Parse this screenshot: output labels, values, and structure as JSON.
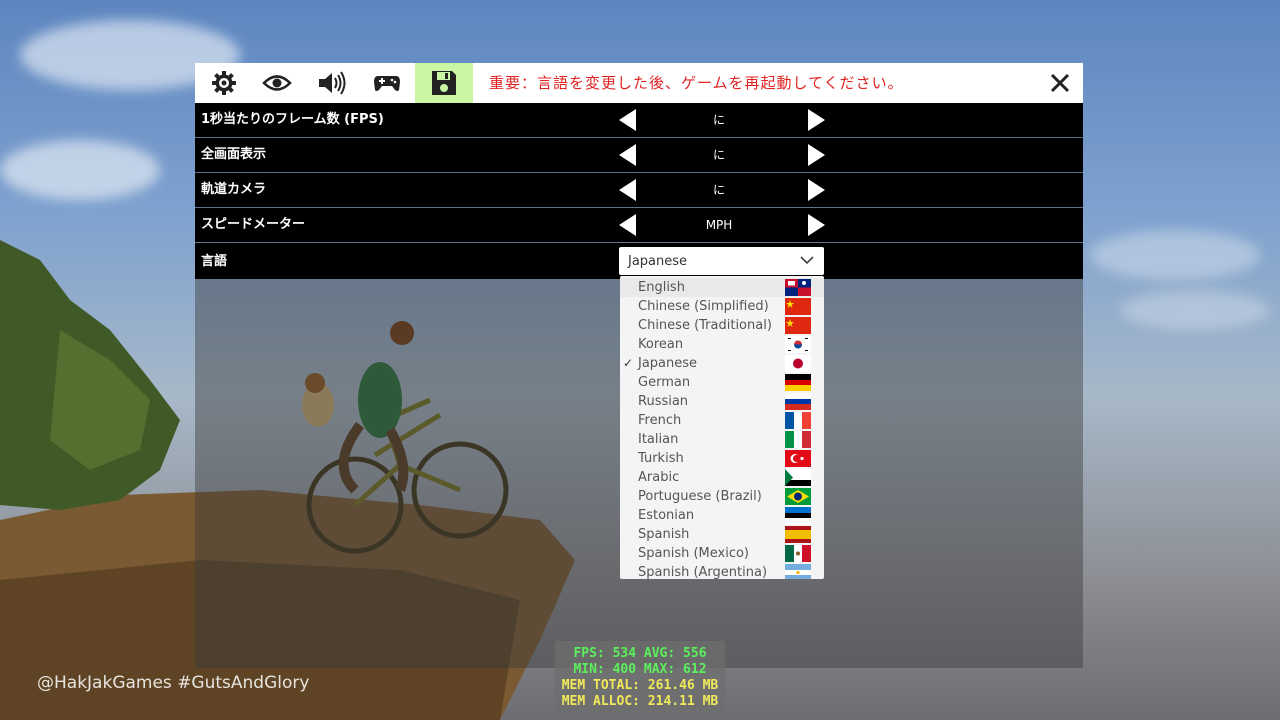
{
  "toolbar": {
    "tabs": [
      {
        "icon": "gear-icon",
        "active": false
      },
      {
        "icon": "eye-icon",
        "active": false
      },
      {
        "icon": "speaker-icon",
        "active": false
      },
      {
        "icon": "gamepad-icon",
        "active": false
      },
      {
        "icon": "save-icon",
        "active": true
      }
    ],
    "notice": "重要：言語を変更した後、ゲームを再起動してください。",
    "close_icon": "close-icon"
  },
  "settings": [
    {
      "label": "1秒当たりのフレーム数 (FPS)",
      "value": "に"
    },
    {
      "label": "全画面表示",
      "value": "に"
    },
    {
      "label": "軌道カメラ",
      "value": "に"
    },
    {
      "label": "スピードメーター",
      "value": "MPH"
    }
  ],
  "language": {
    "label": "言語",
    "selected": "Japanese",
    "options": [
      {
        "name": "English",
        "flag": "flag-icon"
      },
      {
        "name": "Chinese (Simplified)",
        "flag": "china-flag-icon"
      },
      {
        "name": "Chinese (Traditional)",
        "flag": "china-flag-icon"
      },
      {
        "name": "Korean",
        "flag": "korea-flag-icon"
      },
      {
        "name": "Japanese",
        "flag": "japan-flag-icon"
      },
      {
        "name": "German",
        "flag": "germany-flag-icon"
      },
      {
        "name": "Russian",
        "flag": "russia-flag-icon"
      },
      {
        "name": "French",
        "flag": "france-flag-icon"
      },
      {
        "name": "Italian",
        "flag": "italy-flag-icon"
      },
      {
        "name": "Turkish",
        "flag": "turkey-flag-icon"
      },
      {
        "name": "Arabic",
        "flag": "arabic-flag-icon"
      },
      {
        "name": "Portuguese (Brazil)",
        "flag": "brazil-flag-icon"
      },
      {
        "name": "Estonian",
        "flag": "estonia-flag-icon"
      },
      {
        "name": "Spanish",
        "flag": "spain-flag-icon"
      },
      {
        "name": "Spanish (Mexico)",
        "flag": "mexico-flag-icon"
      },
      {
        "name": "Spanish (Argentina)",
        "flag": "argentina-flag-icon"
      }
    ]
  },
  "stats": {
    "line1": "FPS: 534 AVG: 556",
    "line2": "MIN: 400 MAX: 612",
    "line3": "MEM TOTAL: 261.46 MB",
    "line4": "MEM ALLOC: 214.11 MB"
  },
  "watermark": "@HakJakGames #GutsAndGlory",
  "colors": {
    "notice": "#e02222",
    "active_tab": "#c9f5a5",
    "fps_text": "#5bf05b",
    "mem_text": "#f0e85b"
  }
}
